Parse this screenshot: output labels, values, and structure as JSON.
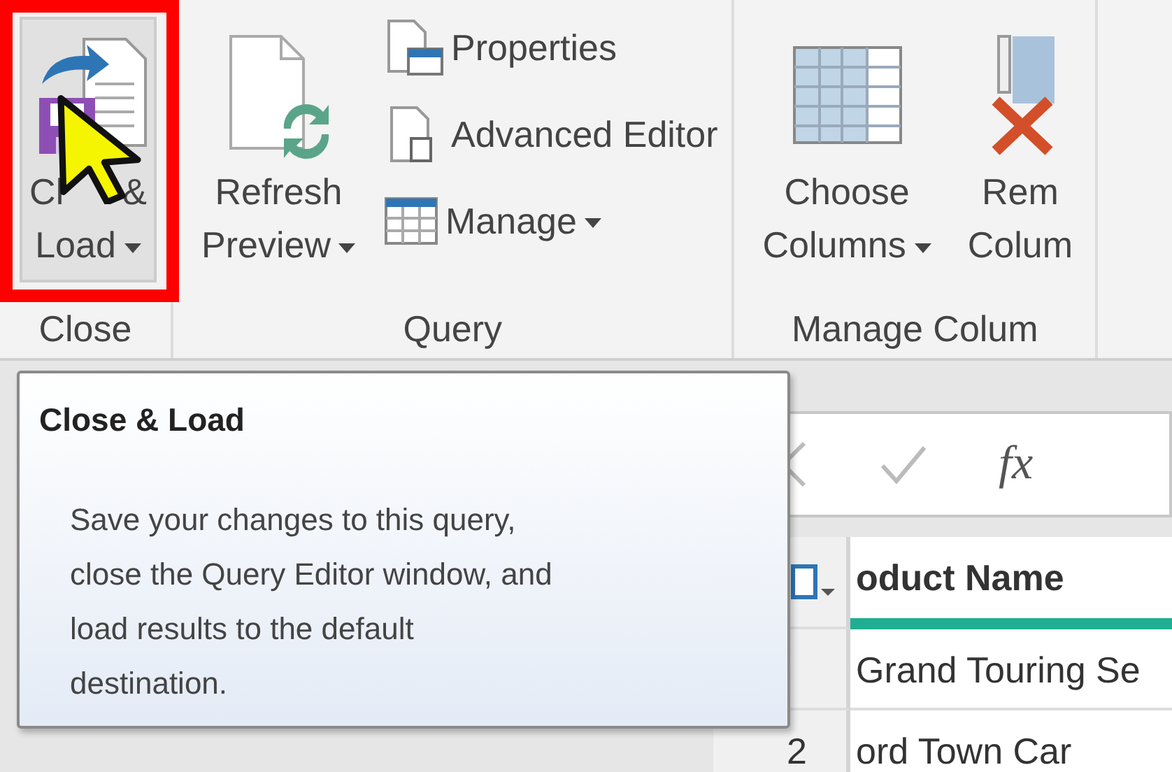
{
  "ribbon": {
    "groups": [
      {
        "label": "Close",
        "items": [
          {
            "kind": "large",
            "lines": [
              [
                "Cl",
                "&"
              ],
              [
                "Load"
              ]
            ],
            "dropdown": true,
            "hovered": true,
            "outlined": true
          }
        ]
      },
      {
        "label": "Query",
        "items": [
          {
            "kind": "large",
            "lines": [
              [
                "Refresh"
              ],
              [
                "Preview"
              ]
            ],
            "dropdown": true,
            "hovered": false,
            "outlined": false
          },
          {
            "kind": "stack",
            "buttons": [
              {
                "label": "Properties",
                "dropdown": false
              },
              {
                "label": "Advanced Editor",
                "dropdown": false
              },
              {
                "label": "Manage",
                "dropdown": true
              }
            ]
          }
        ]
      },
      {
        "label": "Manage Colum",
        "items": [
          {
            "kind": "large",
            "lines": [
              [
                "Choose"
              ],
              [
                "Columns"
              ]
            ],
            "dropdown": true,
            "hovered": false,
            "outlined": false
          },
          {
            "kind": "large",
            "lines": [
              [
                "Rem"
              ],
              [
                "Colum"
              ]
            ],
            "dropdown": false,
            "hovered": false,
            "outlined": false
          }
        ]
      }
    ]
  },
  "tooltip": {
    "title": "Close & Load",
    "lines": [
      "Save your changes to this query,",
      "close the Query Editor window, and",
      "load results to the default",
      "destination."
    ]
  },
  "formula_bar": {
    "function_label": "fx"
  },
  "table": {
    "columns": [
      "oduct Name"
    ],
    "rows": [
      {
        "number": "",
        "cells": [
          "Grand Touring Se"
        ]
      },
      {
        "number": "2",
        "cells": [
          "ord Town Car"
        ]
      }
    ]
  }
}
